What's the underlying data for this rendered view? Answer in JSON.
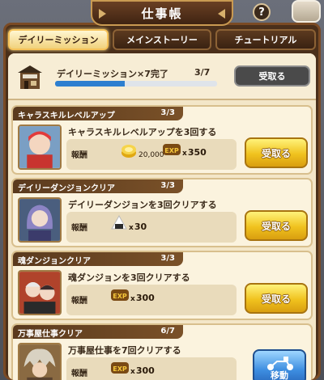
{
  "title": "仕事帳",
  "help": "?",
  "tabs": [
    {
      "label": "デイリーミッション"
    },
    {
      "label": "メインストーリー"
    },
    {
      "label": "チュートリアル"
    }
  ],
  "summary": {
    "label": "デイリーミッション×7完了",
    "count": "3/7",
    "progress_fraction": 0.43,
    "button": "受取る"
  },
  "missions": [
    {
      "name": "キャラスキルレベルアップ",
      "progress": "3/3",
      "desc": "キャラスキルレベルアップを3回する",
      "reward_label": "報酬",
      "rewards": [
        {
          "icon": "gold-coin-icon",
          "amount": "20,000"
        },
        {
          "icon": "exp-icon",
          "amount": "350"
        }
      ],
      "button": "受取る"
    },
    {
      "name": "デイリーダンジョンクリア",
      "progress": "3/3",
      "desc": "デイリーダンジョンを3回クリアする",
      "reward_label": "報酬",
      "rewards": [
        {
          "icon": "rice-ball-icon",
          "amount": "30"
        }
      ],
      "button": "受取る"
    },
    {
      "name": "魂ダンジョンクリア",
      "progress": "3/3",
      "desc": "魂ダンジョンを3回クリアする",
      "reward_label": "報酬",
      "rewards": [
        {
          "icon": "exp-icon",
          "amount": "300"
        }
      ],
      "button": "受取る"
    },
    {
      "name": "万事屋仕事クリア",
      "progress": "6/7",
      "desc": "万事屋仕事を7回クリアする",
      "reward_label": "報酬",
      "rewards": [
        {
          "icon": "exp-icon",
          "amount": "300"
        }
      ],
      "button": "移動"
    }
  ],
  "colors": {
    "accent_gold": "#f0c21e",
    "accent_blue": "#3d8de0",
    "panel": "#f3e6c8",
    "frame": "#4a2f1a"
  }
}
